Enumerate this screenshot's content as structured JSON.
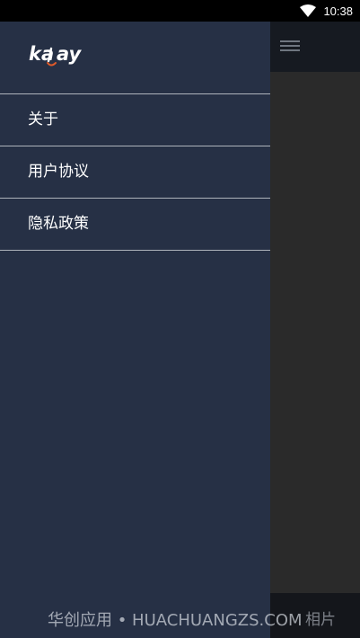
{
  "status_bar": {
    "time": "10:38",
    "wifi_icon": "wifi-icon"
  },
  "app": {
    "menu_icon": "hamburger-menu-icon",
    "bottom_tab_label": "相片"
  },
  "drawer": {
    "logo_text": "kalay",
    "items": [
      {
        "label": "关于"
      },
      {
        "label": "用户协议"
      },
      {
        "label": "隐私政策"
      }
    ]
  },
  "watermark": "华创应用 • HUACHUANGZS.COM",
  "colors": {
    "drawer_bg": "#263045",
    "divider": "#aeb3bb",
    "logo_accent": "#e05a2a"
  }
}
